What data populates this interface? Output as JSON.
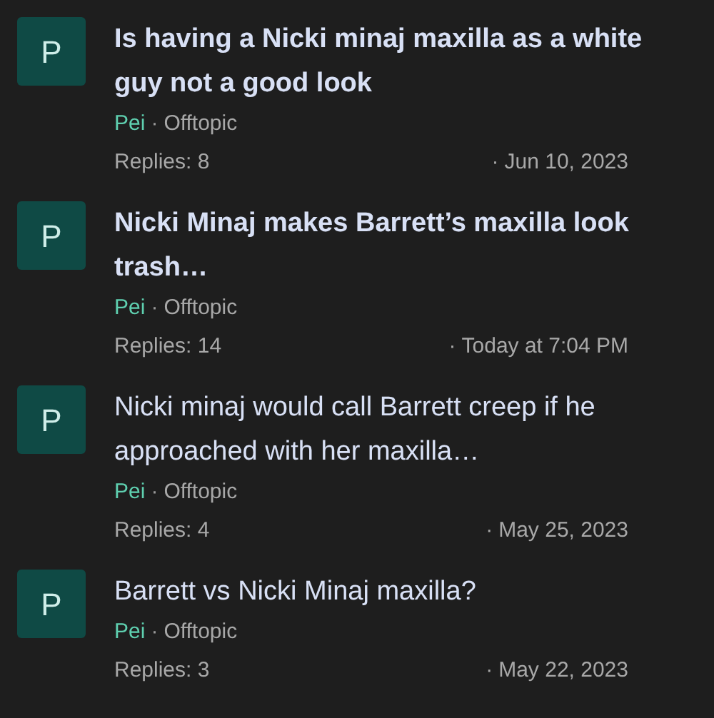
{
  "threads": [
    {
      "avatar": "P",
      "title": "Is having a Nicki minaj maxilla as a white guy not a good look",
      "unread": true,
      "author": "Pei",
      "separator": "·",
      "forum": "Offtopic",
      "replies": "Replies: 8",
      "date_separator": "·",
      "date": "Jun 10, 2023"
    },
    {
      "avatar": "P",
      "title": "Nicki Minaj makes Barrett’s maxilla look trash…",
      "unread": true,
      "author": "Pei",
      "separator": "·",
      "forum": "Offtopic",
      "replies": "Replies: 14",
      "date_separator": "·",
      "date": "Today at 7:04 PM"
    },
    {
      "avatar": "P",
      "title": "Nicki minaj would call Barrett creep if he approached with her maxilla…",
      "unread": false,
      "author": "Pei",
      "separator": "·",
      "forum": "Offtopic",
      "replies": "Replies: 4",
      "date_separator": "·",
      "date": "May 25, 2023"
    },
    {
      "avatar": "P",
      "title": "Barrett vs Nicki Minaj maxilla?",
      "unread": false,
      "author": "Pei",
      "separator": "·",
      "forum": "Offtopic",
      "replies": "Replies: 3",
      "date_separator": "·",
      "date": "May 22, 2023"
    }
  ]
}
